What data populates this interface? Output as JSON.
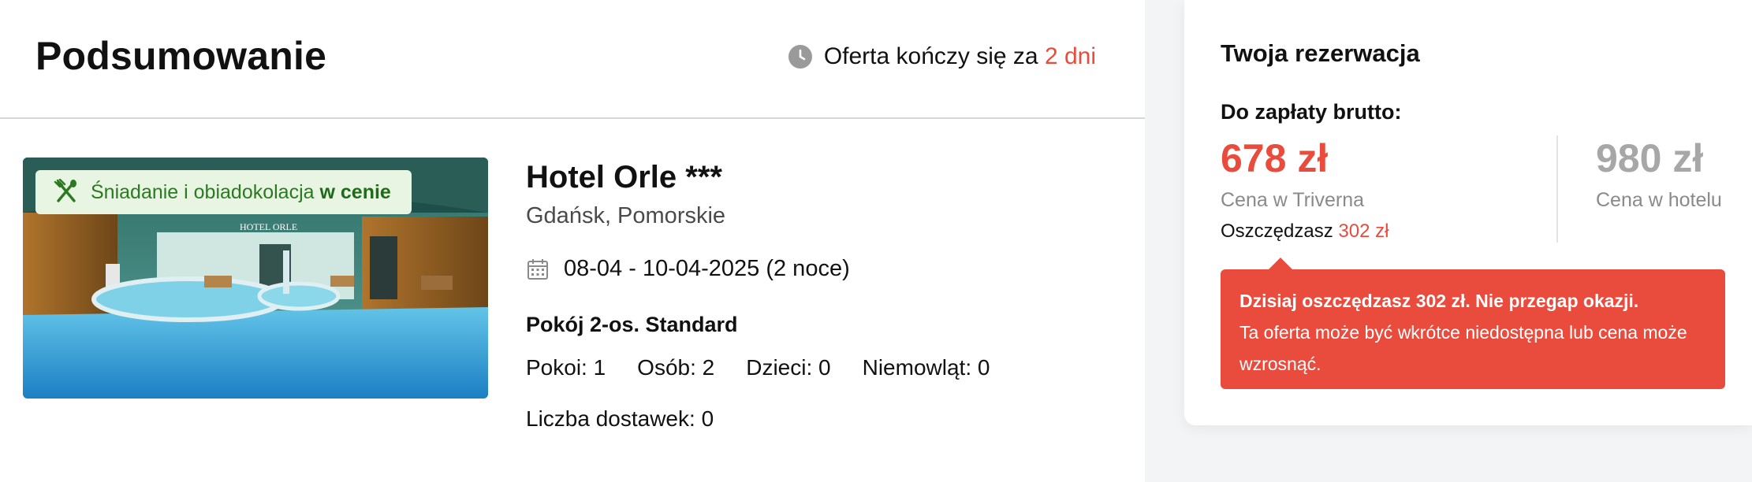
{
  "header": {
    "title": "Podsumowanie",
    "offer_prefix": "Oferta kończy się za",
    "offer_days": "2 dni",
    "clock_icon": "clock-icon"
  },
  "hotel": {
    "meal_badge_prefix": "Śniadanie i obiadokolacja",
    "meal_badge_strong": "w cenie",
    "meal_icon": "cutlery-icon",
    "photo_sign": "HOTEL ORLE",
    "name": "Hotel Orle ***",
    "location": "Gdańsk, Pomorskie",
    "dates": "08-04 - 10-04-2025 (2 noce)",
    "calendar_icon": "calendar-icon",
    "room_type": "Pokój 2-os. Standard",
    "counts": {
      "rooms": "Pokoi: 1",
      "persons": "Osób: 2",
      "children": "Dzieci: 0",
      "infants": "Niemowląt: 0"
    },
    "extra_beds": "Liczba dostawek: 0"
  },
  "reservation": {
    "title": "Twoja rezerwacja",
    "due_label": "Do zapłaty brutto:",
    "price_triverna": "678 zł",
    "price_triverna_label": "Cena w Triverna",
    "savings_prefix": "Oszczędzasz",
    "savings_amount": "302 zł",
    "price_hotel": "980 zł",
    "price_hotel_label": "Cena w hotelu",
    "alert_headline": "Dzisiaj oszczędzasz 302 zł. Nie przegap okazji.",
    "alert_body": "Ta oferta może być wkrótce niedostępna lub cena może wzrosnąć."
  },
  "colors": {
    "accent_red": "#e94b3c",
    "badge_green_bg": "#e9f5e3",
    "badge_green_text": "#2b7a22",
    "muted_gray": "#a7a7a7"
  }
}
